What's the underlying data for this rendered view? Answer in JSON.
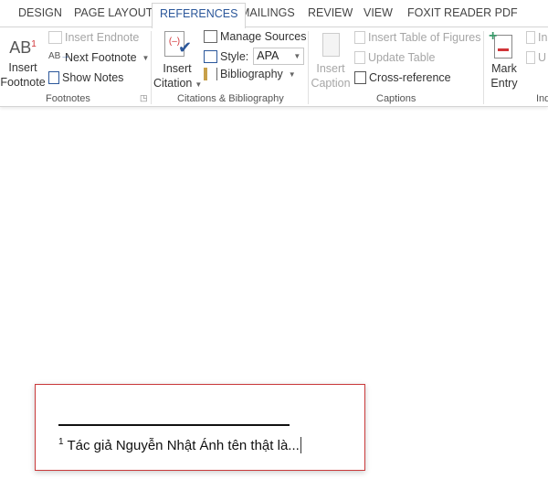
{
  "tabs": [
    {
      "label": "DESIGN"
    },
    {
      "label": "PAGE LAYOUT"
    },
    {
      "label": "REFERENCES",
      "active": true
    },
    {
      "label": "MAILINGS"
    },
    {
      "label": "REVIEW"
    },
    {
      "label": "VIEW"
    },
    {
      "label": "FOXIT READER PDF"
    }
  ],
  "footnotes": {
    "insert_footnote_l1": "Insert",
    "insert_footnote_l2": "Footnote",
    "insert_endnote": "Insert Endnote",
    "next_footnote": "Next Footnote",
    "show_notes": "Show Notes",
    "group": "Footnotes"
  },
  "citations": {
    "insert_citation_l1": "Insert",
    "insert_citation_l2": "Citation",
    "manage_sources": "Manage Sources",
    "style_label": "Style:",
    "style_value": "APA",
    "bibliography": "Bibliography",
    "group": "Citations & Bibliography"
  },
  "captions": {
    "insert_caption_l1": "Insert",
    "insert_caption_l2": "Caption",
    "insert_table_of_figures": "Insert Table of Figures",
    "update_table": "Update Table",
    "cross_reference": "Cross-reference",
    "group": "Captions"
  },
  "index": {
    "mark_entry_l1": "Mark",
    "mark_entry_l2": "Entry",
    "insert_index_partial": "In",
    "update_partial": "U",
    "group_partial": "Ind"
  },
  "document": {
    "footnote_number": "1",
    "footnote_text": "Tác giả Nguyễn Nhật Ánh tên thật là..."
  },
  "colors": {
    "accent": "#2b579a",
    "highlight_border": "#c9393a",
    "superscript_red": "#d13438"
  }
}
